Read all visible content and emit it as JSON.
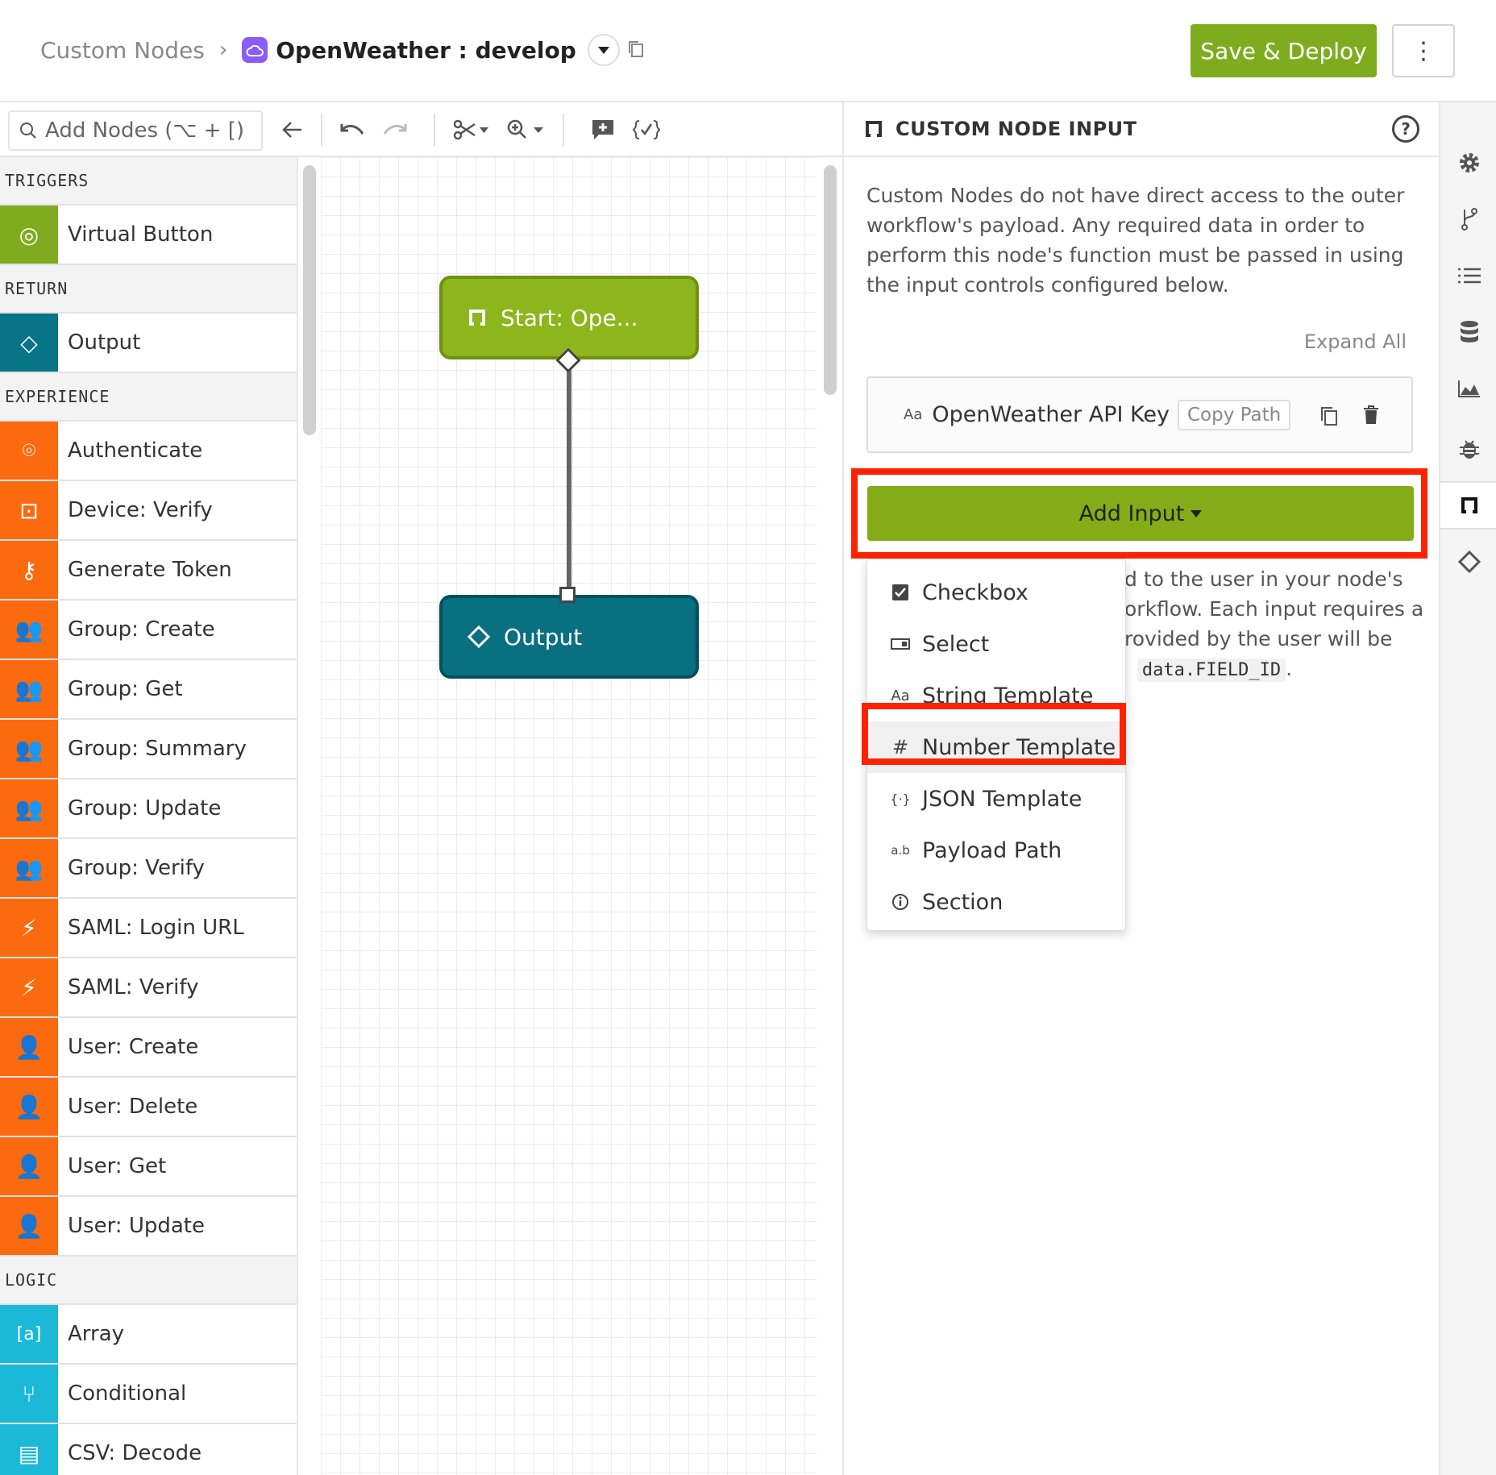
{
  "header": {
    "breadcrumb_root": "Custom Nodes",
    "breadcrumb_sep": "›",
    "title": "OpenWeather : develop",
    "save_label": "Save & Deploy",
    "more_label": "⋮"
  },
  "toolbar": {
    "search_placeholder": "Add Nodes (⌥ + [)"
  },
  "sidebar": {
    "sections": [
      {
        "title": "TRIGGERS",
        "items": [
          {
            "label": "Virtual Button",
            "icon": "radio-target-icon",
            "color": "#7fac1f"
          }
        ]
      },
      {
        "title": "RETURN",
        "items": [
          {
            "label": "Output",
            "icon": "diamond-code-icon",
            "color": "#087488"
          }
        ]
      },
      {
        "title": "EXPERIENCE",
        "items": [
          {
            "label": "Authenticate",
            "icon": "fingerprint-icon",
            "color": "#fb6a0e"
          },
          {
            "label": "Device: Verify",
            "icon": "chip-check-icon",
            "color": "#fb6a0e"
          },
          {
            "label": "Generate Token",
            "icon": "key-icon",
            "color": "#fb6a0e"
          },
          {
            "label": "Group: Create",
            "icon": "group-add-icon",
            "color": "#fb6a0e"
          },
          {
            "label": "Group: Get",
            "icon": "group-search-icon",
            "color": "#fb6a0e"
          },
          {
            "label": "Group: Summary",
            "icon": "group-list-icon",
            "color": "#fb6a0e"
          },
          {
            "label": "Group: Update",
            "icon": "group-edit-icon",
            "color": "#fb6a0e"
          },
          {
            "label": "Group: Verify",
            "icon": "group-check-icon",
            "color": "#fb6a0e"
          },
          {
            "label": "SAML: Login URL",
            "icon": "saml-icon",
            "color": "#fb6a0e"
          },
          {
            "label": "SAML: Verify",
            "icon": "saml-verify-icon",
            "color": "#fb6a0e"
          },
          {
            "label": "User: Create",
            "icon": "user-add-icon",
            "color": "#fb6a0e"
          },
          {
            "label": "User: Delete",
            "icon": "user-remove-icon",
            "color": "#fb6a0e"
          },
          {
            "label": "User: Get",
            "icon": "user-search-icon",
            "color": "#fb6a0e"
          },
          {
            "label": "User: Update",
            "icon": "user-edit-icon",
            "color": "#fb6a0e"
          }
        ]
      },
      {
        "title": "LOGIC",
        "items": [
          {
            "label": "Array",
            "icon": "array-icon",
            "color": "#1bb8d8"
          },
          {
            "label": "Conditional",
            "icon": "fork-icon",
            "color": "#1bb8d8"
          },
          {
            "label": "CSV: Decode",
            "icon": "csv-file-icon",
            "color": "#1bb8d8"
          }
        ]
      }
    ]
  },
  "canvas": {
    "start_node": "Start: Ope...",
    "output_node": "Output"
  },
  "panel": {
    "title": "CUSTOM NODE INPUT",
    "description": "Custom Nodes do not have direct access to the outer workflow's payload. Any required data in order to perform this node's function must be passed in using the input controls configured below.",
    "expand_all": "Expand All",
    "field_type": "Aa",
    "field_name": "OpenWeather API Key",
    "copy_path": "Copy Path",
    "add_input": "Add Input",
    "desc2_a": "d to the user in your node's",
    "desc2_b": "orkflow. Each input requires a",
    "desc2_c": "rovided by the user will be",
    "code": "data.FIELD_ID",
    "desc2_end": "."
  },
  "menu": {
    "items": [
      {
        "label": "Checkbox",
        "icon": "checkbox-icon"
      },
      {
        "label": "Select",
        "icon": "select-icon"
      },
      {
        "label": "String Template",
        "icon": "text-aa-icon"
      },
      {
        "label": "Number Template",
        "icon": "hash-icon"
      },
      {
        "label": "JSON Template",
        "icon": "json-braces-icon"
      },
      {
        "label": "Payload Path",
        "icon": "path-ab-icon"
      },
      {
        "label": "Section",
        "icon": "info-circle-icon"
      }
    ],
    "highlighted": "Number Template"
  },
  "colors": {
    "accent": "#7fac1f",
    "highlight": "#ff2200",
    "teal": "#087488",
    "orange": "#fb6a0e",
    "cyan": "#1bb8d8"
  }
}
